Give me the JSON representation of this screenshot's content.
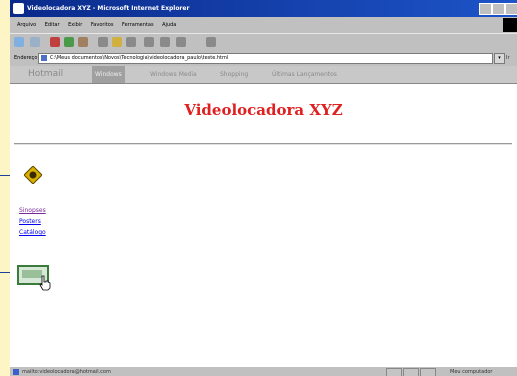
{
  "window": {
    "title": "Videolocadora XYZ - Microsoft Internet Explorer"
  },
  "menu": {
    "items": [
      "Arquivo",
      "Editar",
      "Exibir",
      "Favoritos",
      "Ferramentas",
      "Ajuda"
    ]
  },
  "toolbar": {
    "icons": [
      "back-icon",
      "forward-icon",
      "stop-icon",
      "refresh-icon",
      "home-icon",
      "search-icon",
      "favorites-icon",
      "history-icon",
      "mail-icon",
      "print-icon",
      "edit-icon",
      "discuss-icon"
    ]
  },
  "address": {
    "label": "Endereço",
    "url": "C:\\Meus documentos\\Novos\\Tecnologia\\videolocadora_paulo\\teste.html",
    "go_label": "Ir"
  },
  "links": {
    "hotmail": "Hotmail",
    "channel": "Windows",
    "media": "Windows Media",
    "shopping": "Shopping",
    "updates": "Últimas Lançamentos"
  },
  "page": {
    "title": "Videolocadora XYZ",
    "nav_links": [
      "Sinopses",
      "Posters",
      "Catálogo"
    ]
  },
  "status": {
    "text": "mailto:videolocadora@hotmail.com",
    "zone": "Meu computador"
  },
  "colors": {
    "title_red": "#e02020",
    "link_blue": "#0000ee",
    "titlebar_blue": "#0a2a8a",
    "page_background": "#fdf5c5"
  }
}
